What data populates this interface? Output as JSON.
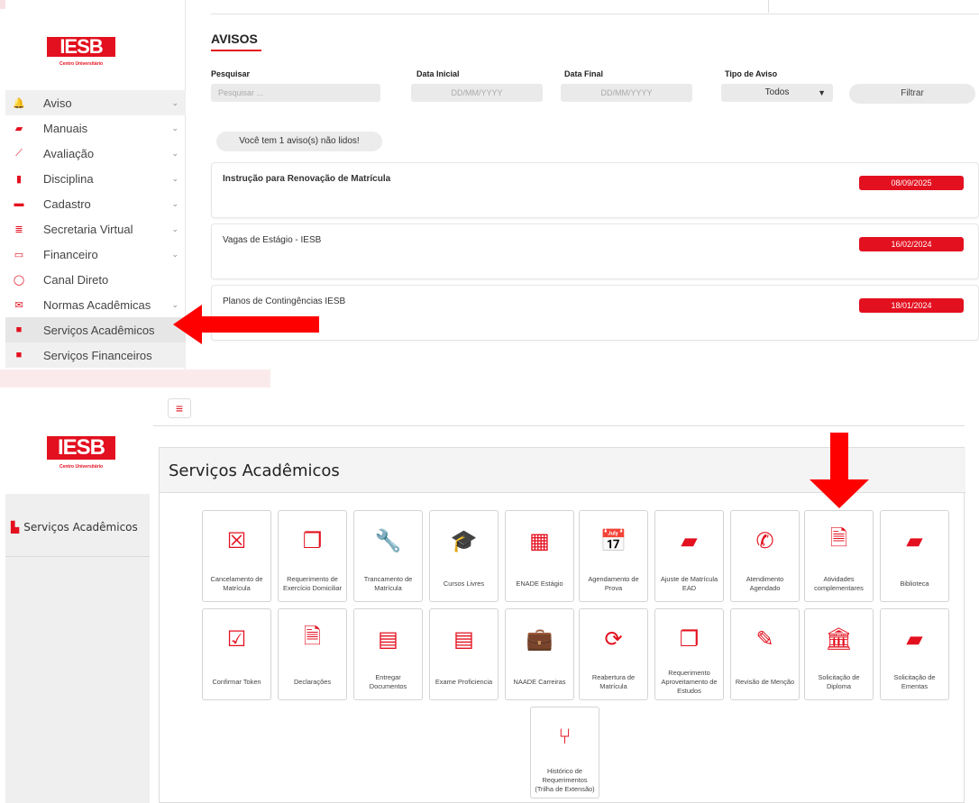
{
  "top": {
    "logo": {
      "text": "IESB",
      "subtitle": "Centro Universitário"
    },
    "menu": [
      {
        "label": "Aviso",
        "icon": "bell-icon",
        "glyph": "🔔",
        "chevron": true,
        "state": "gray"
      },
      {
        "label": "Manuais",
        "icon": "book-icon",
        "glyph": "▰",
        "chevron": true
      },
      {
        "label": "Avaliação",
        "icon": "chart-line-icon",
        "glyph": "⟋",
        "chevron": true
      },
      {
        "label": "Disciplina",
        "icon": "book-open-icon",
        "glyph": "▮",
        "chevron": true
      },
      {
        "label": "Cadastro",
        "icon": "id-card-icon",
        "glyph": "▬",
        "chevron": true
      },
      {
        "label": "Secretaria Virtual",
        "icon": "list-icon",
        "glyph": "≣",
        "chevron": true
      },
      {
        "label": "Financeiro",
        "icon": "money-icon",
        "glyph": "▭",
        "chevron": true
      },
      {
        "label": "Canal Direto",
        "icon": "chat-icon",
        "glyph": "◯",
        "chevron": false
      },
      {
        "label": "Normas Acadêmicas",
        "icon": "envelope-icon",
        "glyph": "✉",
        "chevron": true
      },
      {
        "label": "Serviços Acadêmicos",
        "icon": "file-icon",
        "glyph": "■",
        "chevron": false,
        "state": "active"
      },
      {
        "label": "Serviços Financeiros",
        "icon": "file-icon",
        "glyph": "■",
        "chevron": false,
        "state": "gray"
      }
    ],
    "avisos": {
      "title": "AVISOS",
      "filters": {
        "search_label": "Pesquisar",
        "search_placeholder": "Pesquisar ...",
        "start_label": "Data Inicial",
        "start_placeholder": "DD/MM/YYYY",
        "end_label": "Data Final",
        "end_placeholder": "DD/MM/YYYY",
        "type_label": "Tipo de Aviso",
        "type_value": "Todos",
        "filter_button": "Filtrar"
      },
      "unread": "Você tem 1 aviso(s) não lidos!",
      "items": [
        {
          "title": "Instrução para Renovação de Matrícula",
          "date": "08/09/2025",
          "bold": true
        },
        {
          "title": "Vagas de Estágio - IESB",
          "date": "16/02/2024",
          "bold": false
        },
        {
          "title": "Planos de Contingências IESB",
          "date": "18/01/2024",
          "bold": false
        }
      ]
    }
  },
  "bottom": {
    "logo": {
      "text": "IESB",
      "subtitle": "Centro Universitário"
    },
    "sidebar_item": "Serviços Acadêmicos",
    "panel_title": "Serviços Acadêmicos",
    "tiles": [
      {
        "label": "Cancelamento de Matrícula",
        "icon": "square-x-icon",
        "glyph": "☒"
      },
      {
        "label": "Requerimento de Exercício Domiciliar",
        "icon": "files-icon",
        "glyph": "❐"
      },
      {
        "label": "Trancamento de Matrícula",
        "icon": "wrench-icon",
        "glyph": "🔧"
      },
      {
        "label": "Cursos Livres",
        "icon": "graduation-cap-icon",
        "glyph": "🎓"
      },
      {
        "label": "ENADE Estágio",
        "icon": "building-icon",
        "glyph": "▦"
      },
      {
        "label": "Agendamento de Prova",
        "icon": "calendar-check-icon",
        "glyph": "📅"
      },
      {
        "label": "Ajuste de Matrícula EAD",
        "icon": "book-icon",
        "glyph": "▰"
      },
      {
        "label": "Atendimento Agendado",
        "icon": "phone-icon",
        "glyph": "✆"
      },
      {
        "label": "Atividades complementares",
        "icon": "file-text-icon",
        "glyph": "🗎"
      },
      {
        "label": "Biblioteca",
        "icon": "book-icon",
        "glyph": "▰"
      },
      {
        "label": "Confirmar Token",
        "icon": "check-square-icon",
        "glyph": "☑"
      },
      {
        "label": "Declarações",
        "icon": "file-text-icon",
        "glyph": "🗎"
      },
      {
        "label": "Entregar Documentos",
        "icon": "file-solid-icon",
        "glyph": "▤"
      },
      {
        "label": "Exame Proficiencia",
        "icon": "list-alt-icon",
        "glyph": "▤"
      },
      {
        "label": "NAADE Carreiras",
        "icon": "briefcase-icon",
        "glyph": "💼"
      },
      {
        "label": "Reabertura de Matrícula",
        "icon": "refresh-icon",
        "glyph": "⟳"
      },
      {
        "label": "Requerimento Aproveitamento de Estudos",
        "icon": "files-icon",
        "glyph": "❐"
      },
      {
        "label": "Revisão de Menção",
        "icon": "edit-icon",
        "glyph": "✎"
      },
      {
        "label": "Solicitação de Diploma",
        "icon": "bank-icon",
        "glyph": "🏛"
      },
      {
        "label": "Solicitação de Ementas",
        "icon": "book-icon",
        "glyph": "▰"
      },
      {
        "label": "Histórico de Requerimentos (Trilha de Extensão)",
        "icon": "code-branch-icon",
        "glyph": "⑂"
      }
    ]
  },
  "colors": {
    "accent": "#e3101f",
    "arrow": "#ff0000"
  }
}
